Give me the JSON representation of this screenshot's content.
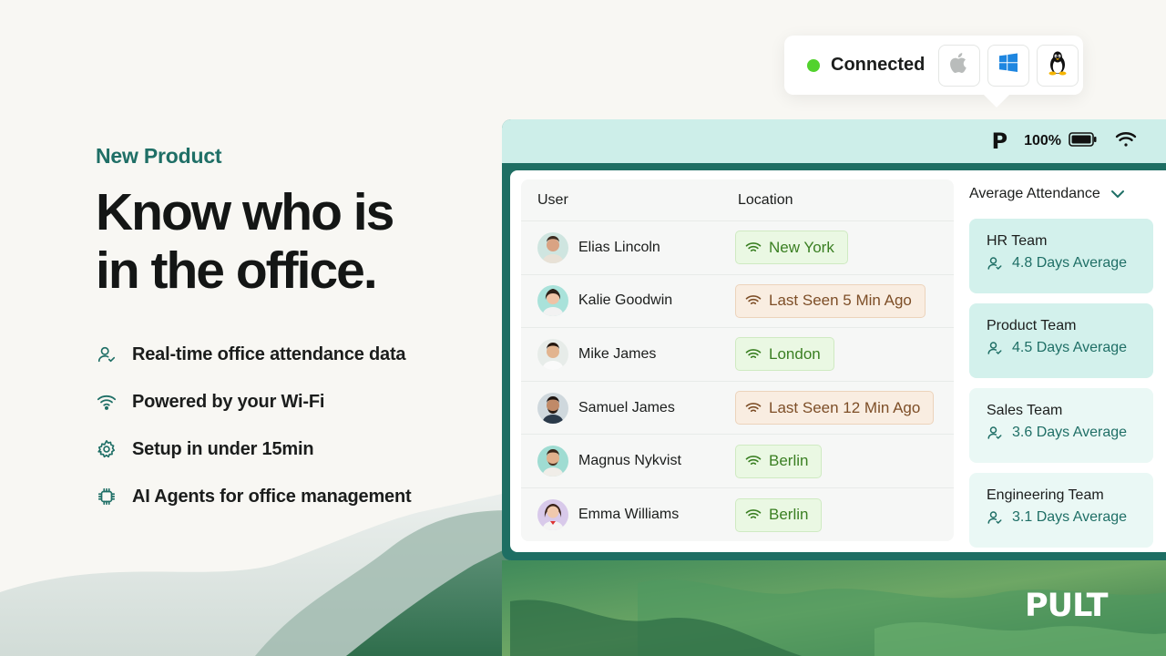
{
  "hero": {
    "eyebrow": "New Product",
    "headline_line1": "Know who is",
    "headline_line2": "in the office.",
    "features": [
      {
        "icon": "user-check-icon",
        "text": "Real-time office attendance data"
      },
      {
        "icon": "wifi-icon",
        "text": "Powered by your Wi-Fi"
      },
      {
        "icon": "gear-icon",
        "text": "Setup in under 15min"
      },
      {
        "icon": "chip-icon",
        "text": "AI Agents for office management"
      }
    ]
  },
  "status": {
    "label": "Connected",
    "color": "#52d22d",
    "platforms": [
      "apple-icon",
      "windows-icon",
      "linux-icon"
    ]
  },
  "menubar": {
    "app_icon": "P",
    "battery": "100%"
  },
  "table": {
    "columns": {
      "user": "User",
      "location": "Location"
    },
    "rows": [
      {
        "name": "Elias Lincoln",
        "location": "New York",
        "status": "online"
      },
      {
        "name": "Kalie Goodwin",
        "location": "Last Seen 5 Min Ago",
        "status": "away"
      },
      {
        "name": "Mike James",
        "location": "London",
        "status": "online"
      },
      {
        "name": "Samuel James",
        "location": "Last Seen 12 Min Ago",
        "status": "away"
      },
      {
        "name": "Magnus Nykvist",
        "location": "Berlin",
        "status": "online"
      },
      {
        "name": "Emma Williams",
        "location": "Berlin",
        "status": "online"
      }
    ]
  },
  "attendance": {
    "title": "Average Attendance",
    "teams": [
      {
        "name": "HR Team",
        "average": "4.8 Days Average"
      },
      {
        "name": "Product Team",
        "average": "4.5 Days Average"
      },
      {
        "name": "Sales Team",
        "average": "3.6 Days Average"
      },
      {
        "name": "Engineering Team",
        "average": "3.1 Days Average"
      }
    ]
  },
  "brand": "PULT",
  "colors": {
    "accent": "#1f6f66",
    "online_text": "#3a7f22",
    "away_text": "#7d4e27"
  }
}
